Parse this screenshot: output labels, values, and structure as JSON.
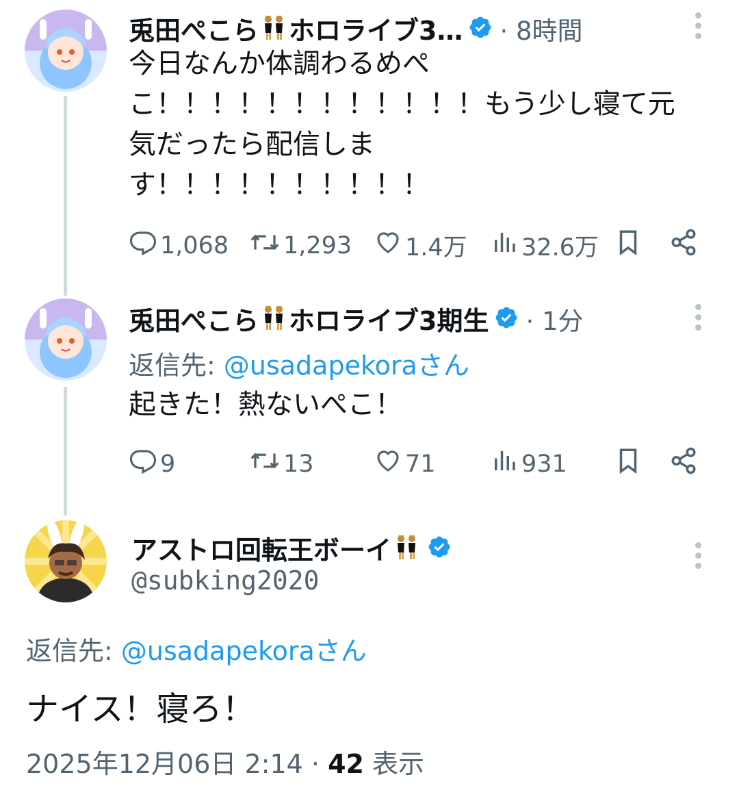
{
  "colors": {
    "accent": "#1d9bf0",
    "muted": "#536471",
    "text": "#0f1419",
    "thread_line": "#cfd9de"
  },
  "tweets": [
    {
      "display_name": "兎田ぺこら",
      "display_name_suffix": "ホロライブ3…",
      "emoji": "👯",
      "verified": true,
      "time": "· 8時間",
      "text": "今日なんか体調わるめぺ\nこ！！！！！！！！！！！！もう少し寝て元\n気だったら配信しま\nす！！！！！！！！！！",
      "actions": {
        "replies": "1,068",
        "retweets": "1,293",
        "likes": "1.4万",
        "views": "32.6万"
      }
    },
    {
      "display_name": "兎田ぺこら",
      "display_name_suffix": "ホロライブ3期生",
      "emoji": "👯",
      "verified": true,
      "time": "· 1分",
      "reply_to_prefix": "返信先: ",
      "reply_to_handle": "@usadapekora",
      "reply_to_suffix": "さん",
      "text": "起きた！熱ないぺこ！",
      "actions": {
        "replies": "9",
        "retweets": "13",
        "likes": "71",
        "views": "931"
      }
    }
  ],
  "main_tweet": {
    "display_name": "アストロ回転王ボーイ",
    "emoji": "👯",
    "verified": true,
    "handle": "@subking2020",
    "reply_to_prefix": "返信先: ",
    "reply_to_handle": "@usadapekora",
    "reply_to_suffix": "さん",
    "text": "ナイス！寝ろ！",
    "timestamp": "2025年12月06日 2:14 · ",
    "view_count": "42",
    "view_label": " 表示"
  }
}
